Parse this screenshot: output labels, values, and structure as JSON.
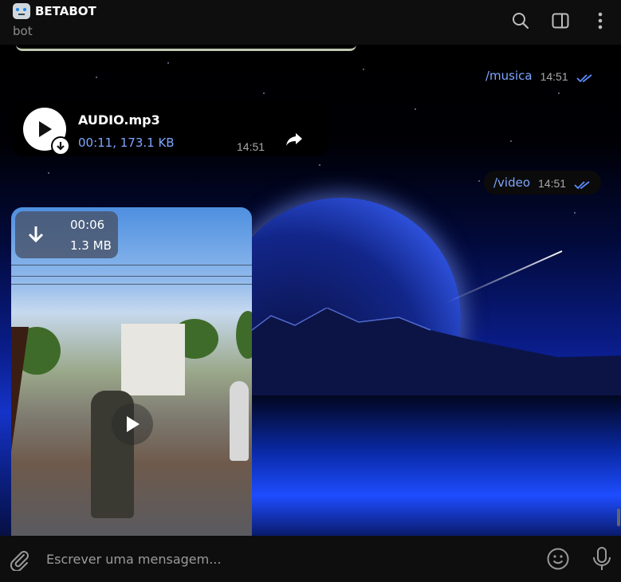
{
  "header": {
    "title": "BETABOT",
    "subtitle": "bot",
    "icons": [
      "robot-emoji",
      "search-icon",
      "sidebar-toggle-icon",
      "more-vertical-icon"
    ]
  },
  "messages": {
    "outgoing_music": {
      "text": "/musica",
      "time": "14:51",
      "status": "read"
    },
    "audio": {
      "file_name": "AUDIO.mp3",
      "meta": "00:11, 173.1 KB",
      "time": "14:51"
    },
    "outgoing_video": {
      "text": "/video",
      "time": "14:51",
      "status": "read"
    },
    "video": {
      "duration": "00:06",
      "size": "1.3 MB"
    }
  },
  "composer": {
    "placeholder": "Escrever uma mensagem...",
    "icons": [
      "paperclip-icon",
      "emoji-icon",
      "microphone-icon"
    ]
  },
  "colors": {
    "accent": "#7ea6ff",
    "header_bg": "#0e0e0e",
    "meta_text": "#a9a9a9"
  }
}
